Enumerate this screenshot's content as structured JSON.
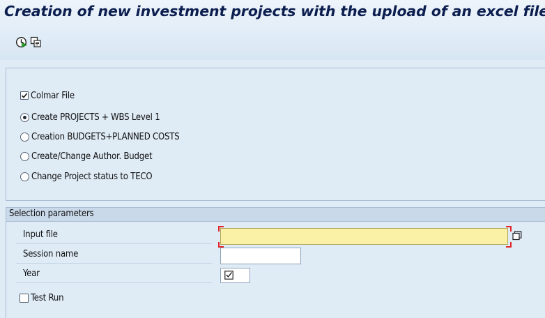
{
  "window": {
    "title": "Creation of new investment projects with the upload of an excel file"
  },
  "toolbar": {
    "buttons": [
      {
        "icon": "execute-icon"
      },
      {
        "icon": "copy-icon"
      }
    ]
  },
  "options": {
    "colmar_file": {
      "label": "Colmar File",
      "checked": true
    },
    "radios": [
      {
        "label": "Create PROJECTS + WBS Level 1",
        "selected": true
      },
      {
        "label": "Creation BUDGETS+PLANNED COSTS",
        "selected": false
      },
      {
        "label": "Create/Change Author. Budget",
        "selected": false
      },
      {
        "label": "Change Project status to TECO",
        "selected": false
      }
    ]
  },
  "selection": {
    "title": "Selection parameters",
    "input_file": {
      "label": "Input file",
      "value": ""
    },
    "session_name": {
      "label": "Session name",
      "value": ""
    },
    "year": {
      "label": "Year",
      "icon": "checkbox-checked-icon"
    },
    "test_run": {
      "label": "Test Run",
      "checked": false
    }
  },
  "colors": {
    "title_text": "#0c1e4f",
    "background": "#dfebf5",
    "required_field": "#faf0a6",
    "required_marker": "#e0262b"
  }
}
